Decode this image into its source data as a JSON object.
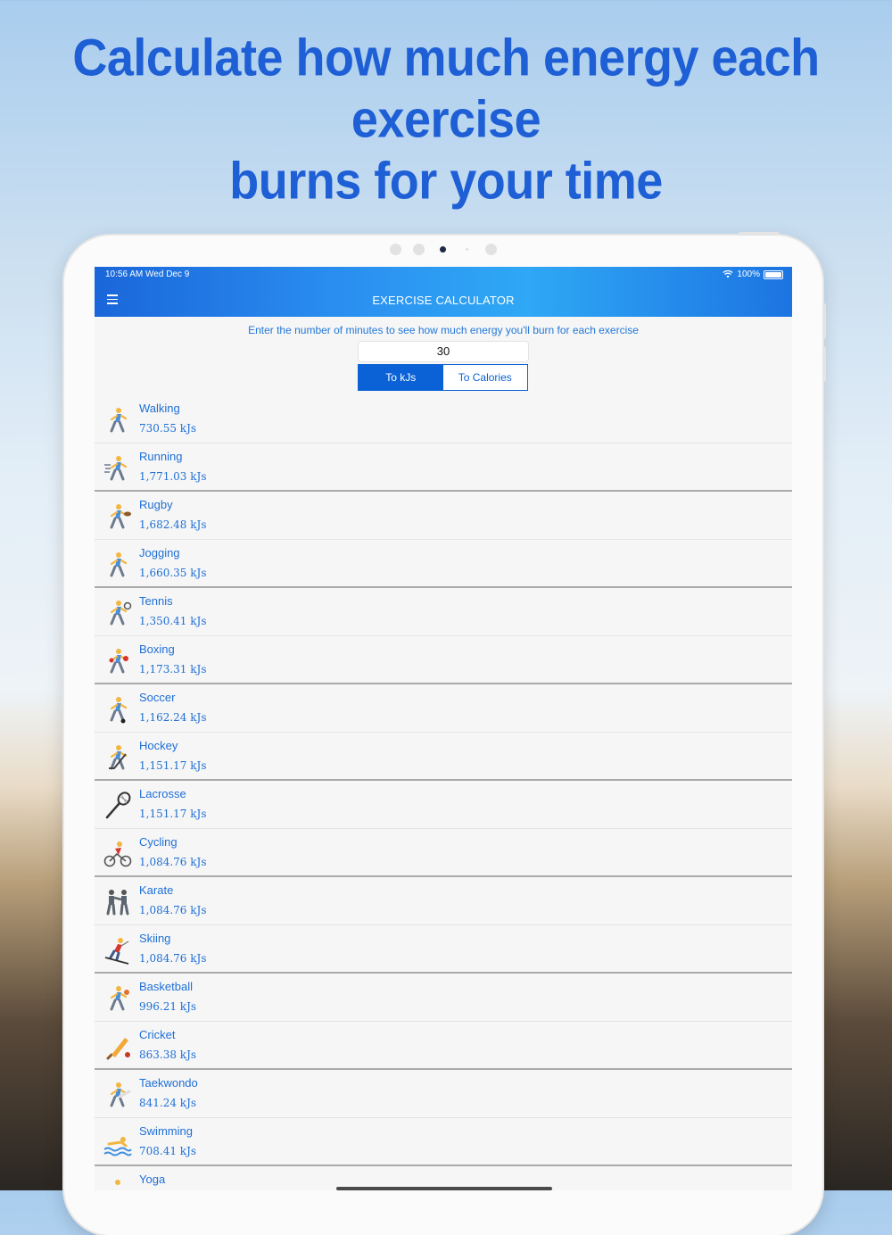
{
  "headline": [
    "Calculate how much energy each exercise",
    "burns for your time"
  ],
  "status_bar": {
    "time": "10:56 AM   Wed Dec 9",
    "battery": "100%"
  },
  "navbar": {
    "title": "EXERCISE CALCULATOR",
    "menu_icon": "hamburger-menu-icon"
  },
  "instructions": "Enter the number of minutes to see how much energy you'll burn for each exercise",
  "minutes_value": "30",
  "toggle": {
    "options": [
      "To kJs",
      "To Calories"
    ],
    "selected": "To kJs"
  },
  "colors": {
    "accent": "#0a62d6",
    "headline": "#1e5fd6",
    "text_blue": "#1e6fd6"
  },
  "exercises": [
    {
      "name": "Walking",
      "value": "730.55 kJs",
      "icon": "walking-person-icon"
    },
    {
      "name": "Running",
      "value": "1,771.03 kJs",
      "icon": "running-person-icon"
    },
    {
      "name": "Rugby",
      "value": "1,682.48 kJs",
      "icon": "rugby-player-icon"
    },
    {
      "name": "Jogging",
      "value": "1,660.35 kJs",
      "icon": "jogging-person-icon"
    },
    {
      "name": "Tennis",
      "value": "1,350.41 kJs",
      "icon": "tennis-player-icon"
    },
    {
      "name": "Boxing",
      "value": "1,173.31 kJs",
      "icon": "boxer-icon"
    },
    {
      "name": "Soccer",
      "value": "1,162.24 kJs",
      "icon": "soccer-player-icon"
    },
    {
      "name": "Hockey",
      "value": "1,151.17 kJs",
      "icon": "hockey-player-icon"
    },
    {
      "name": "Lacrosse",
      "value": "1,151.17 kJs",
      "icon": "lacrosse-stick-icon"
    },
    {
      "name": "Cycling",
      "value": "1,084.76 kJs",
      "icon": "cyclist-icon"
    },
    {
      "name": "Karate",
      "value": "1,084.76 kJs",
      "icon": "karate-fighters-icon"
    },
    {
      "name": "Skiing",
      "value": "1,084.76 kJs",
      "icon": "skier-icon"
    },
    {
      "name": "Basketball",
      "value": "996.21 kJs",
      "icon": "basketball-player-icon"
    },
    {
      "name": "Cricket",
      "value": "863.38 kJs",
      "icon": "cricket-bat-icon"
    },
    {
      "name": "Taekwondo",
      "value": "841.24 kJs",
      "icon": "taekwondo-kick-icon"
    },
    {
      "name": "Swimming",
      "value": "708.41 kJs",
      "icon": "swimmer-icon"
    },
    {
      "name": "Yoga",
      "value": "",
      "icon": "yoga-pose-icon"
    }
  ]
}
